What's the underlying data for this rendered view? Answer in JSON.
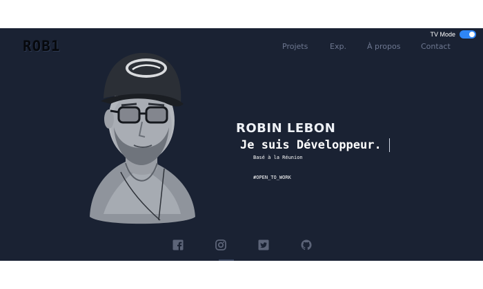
{
  "brand": {
    "logo": "ROB1"
  },
  "nav": {
    "items": [
      {
        "label": "Projets"
      },
      {
        "label": "Exp."
      },
      {
        "label": "À propos"
      },
      {
        "label": "Contact"
      }
    ]
  },
  "tv_mode": {
    "label": "TV Mode",
    "enabled": true
  },
  "hero": {
    "name": "ROBIN LEBON",
    "headline": "Je suis Développeur.",
    "location": "Basé à la Réunion",
    "tag": "#OPEN_TO_WORK"
  },
  "socials": [
    {
      "icon": "facebook-icon"
    },
    {
      "icon": "instagram-icon"
    },
    {
      "icon": "twitter-icon"
    },
    {
      "icon": "github-icon"
    }
  ],
  "colors": {
    "background": "#1a2233",
    "nav_text": "#6e7891",
    "toggle_accent": "#2f86f6",
    "text": "#ffffff"
  }
}
